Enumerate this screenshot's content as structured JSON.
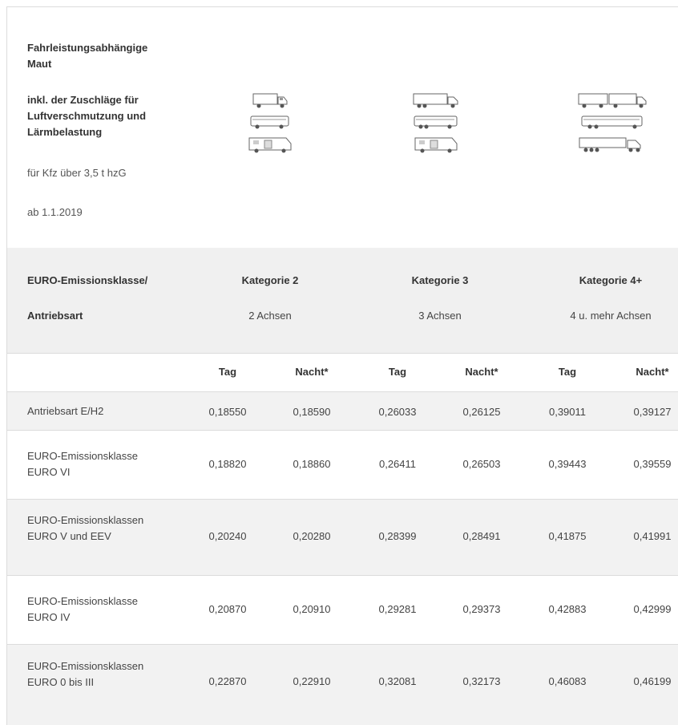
{
  "header": {
    "title": "Fahrleistungsabhängige Maut",
    "subtitle": "inkl. der Zuschläge für Luftverschmutzung und Lärmbelastung",
    "scope": "für Kfz über 3,5 t hzG",
    "date": "ab 1.1.2019",
    "icons": [
      "truck-icon",
      "bus-icon",
      "camper-icon",
      "trailer-truck-icon"
    ]
  },
  "categories": {
    "label_line1": "EURO-Emissionsklasse/",
    "label_line2": "Antriebsart",
    "items": [
      {
        "name": "Kategorie 2",
        "axles": "2 Achsen"
      },
      {
        "name": "Kategorie 3",
        "axles": "3 Achsen"
      },
      {
        "name": "Kategorie 4+",
        "axles": "4 u. mehr Achsen"
      }
    ]
  },
  "table": {
    "col_headers": [
      "Tag",
      "Nacht*",
      "Tag",
      "Nacht*",
      "Tag",
      "Nacht*"
    ],
    "rows": [
      {
        "label": "Antriebsart E/H2",
        "values": [
          "0,18550",
          "0,18590",
          "0,26033",
          "0,26125",
          "0,39011",
          "0,39127"
        ]
      },
      {
        "label": "EURO-Emissionsklasse EURO VI",
        "values": [
          "0,18820",
          "0,18860",
          "0,26411",
          "0,26503",
          "0,39443",
          "0,39559"
        ]
      },
      {
        "label": "EURO-Emissionsklassen EURO V und EEV",
        "values": [
          "0,20240",
          "0,20280",
          "0,28399",
          "0,28491",
          "0,41875",
          "0,41991"
        ]
      },
      {
        "label": "EURO-Emissionsklasse EURO IV",
        "values": [
          "0,20870",
          "0,20910",
          "0,29281",
          "0,29373",
          "0,42883",
          "0,42999"
        ]
      },
      {
        "label": "EURO-Emissionsklassen EURO 0 bis III",
        "values": [
          "0,22870",
          "0,22910",
          "0,32081",
          "0,32173",
          "0,46083",
          "0,46199"
        ]
      }
    ]
  }
}
